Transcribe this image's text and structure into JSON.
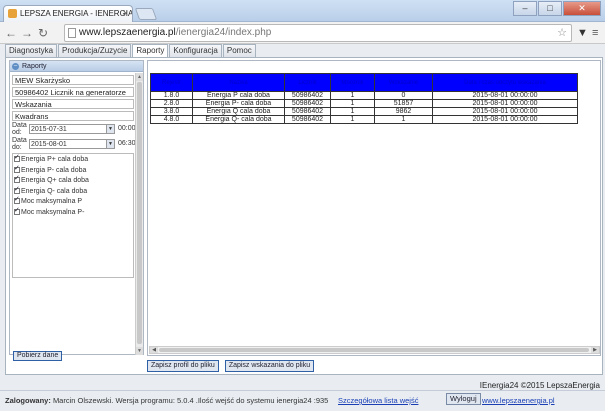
{
  "browser": {
    "tab_title": "LEPSZA ENERGIA - IENERGIA",
    "tab_close": "×",
    "url_host": "www.lepszaenergia.pl",
    "url_path": "/ienergia24/index.php",
    "window_controls": {
      "minimize": "–",
      "maximize": "□",
      "close": "✕"
    }
  },
  "app_tabs": [
    "Diagnostyka",
    "Produkcja/Zuzycie",
    "Raporty",
    "Konfiguracja",
    "Pomoc"
  ],
  "panel": {
    "title": "Raporty",
    "info": [
      "MEW Skarżysko",
      "50986402 Licznik na generatorze",
      "Wskazania",
      "Kwadrans"
    ],
    "date_from_label": "Data od:",
    "date_from": "2015-07-31",
    "time_from": "00:00",
    "date_to_label": "Data do:",
    "date_to": "2015-08-01",
    "time_to": "06:30",
    "checks": [
      "Energia P+ cala doba",
      "Energia P- cala doba",
      "Energia Q+ cala doba",
      "Energia Q- cala doba",
      "Moc maksymalna P",
      "Moc maksymalna P-"
    ],
    "fetch_button": "Pobierz dane"
  },
  "table": {
    "headers": [
      "Rejestr",
      "Nazwa",
      "Licznik",
      "Mnożnik",
      "Wskazanie",
      "Data i czas odczytu wskazania"
    ],
    "rows": [
      [
        "1.8.0",
        "Energia P cala doba",
        "50986402",
        "1",
        "0",
        "2015-08-01 00:00:00"
      ],
      [
        "2.8.0",
        "Energia P- cala doba",
        "50986402",
        "1",
        "51857",
        "2015-08-01 00:00:00"
      ],
      [
        "3.8.0",
        "Energia Q cala doba",
        "50986402",
        "1",
        "9862",
        "2015-08-01 00:00:00"
      ],
      [
        "4.8.0",
        "Energia Q- cala doba",
        "50986402",
        "1",
        "1",
        "2015-08-01 00:00:00"
      ]
    ]
  },
  "buttons": {
    "save_profile": "Zapisz profil do pliku",
    "save_readings": "Zapisz wskazania do pliku"
  },
  "footer": {
    "brand": "IEnergia24 ©2015 LepszaEnergia",
    "logged_label": "Zalogowany:",
    "user_info": "Marcin Olszewski. Wersja programu: 5.0.4 .Ilość wejść do systemu ienergia24 :935",
    "details_link": "Szczegółowa lista wejść",
    "logout": "Wyloguj",
    "site_link": "www.lepszaenergia.pl"
  }
}
